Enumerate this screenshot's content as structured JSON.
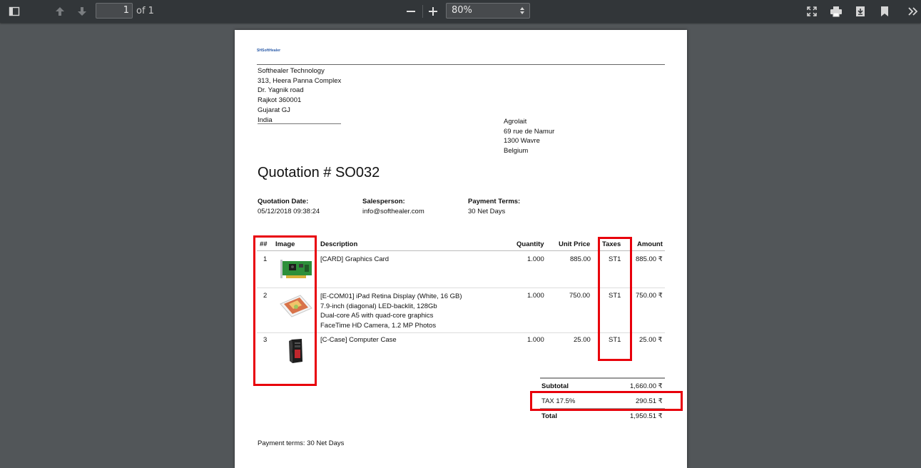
{
  "toolbar": {
    "page_number": "1",
    "page_of": "of 1",
    "zoom": "80%"
  },
  "document": {
    "logo_text": "SHSoftHealer",
    "company": {
      "name": "Softhealer Technology",
      "line1": "313, Heera Panna Complex",
      "line2": "Dr. Yagnik road",
      "line3": "Rajkot 360001",
      "line4": "Gujarat GJ",
      "line5": "India"
    },
    "partner": {
      "name": "Agrolait",
      "line1": "69 rue de Namur",
      "line2": "1300 Wavre",
      "line3": "Belgium"
    },
    "title": "Quotation # SO032",
    "info": {
      "date_label": "Quotation Date:",
      "date_value": "05/12/2018 09:38:24",
      "salesperson_label": "Salesperson:",
      "salesperson_value": "info@softhealer.com",
      "terms_label": "Payment Terms:",
      "terms_value": "30 Net Days"
    },
    "table": {
      "headers": {
        "num": "##",
        "image": "Image",
        "description": "Description",
        "quantity": "Quantity",
        "unit_price": "Unit Price",
        "taxes": "Taxes",
        "amount": "Amount"
      },
      "rows": [
        {
          "num": "1",
          "image": "graphics-card-image",
          "description": [
            "[CARD] Graphics Card"
          ],
          "quantity": "1.000",
          "unit_price": "885.00",
          "taxes": "ST1",
          "amount": "885.00 ₹"
        },
        {
          "num": "2",
          "image": "ipad-image",
          "description": [
            "[E-COM01] iPad Retina Display (White, 16 GB)",
            "7.9-inch (diagonal) LED-backlit, 128Gb",
            "Dual-core A5 with quad-core graphics",
            "FaceTime HD Camera, 1.2 MP Photos"
          ],
          "quantity": "1.000",
          "unit_price": "750.00",
          "taxes": "ST1",
          "amount": "750.00 ₹"
        },
        {
          "num": "3",
          "image": "computer-case-image",
          "description": [
            "[C-Case] Computer Case"
          ],
          "quantity": "1.000",
          "unit_price": "25.00",
          "taxes": "ST1",
          "amount": "25.00 ₹"
        }
      ]
    },
    "totals": {
      "subtotal_label": "Subtotal",
      "subtotal_value": "1,660.00 ₹",
      "tax_label": "TAX 17.5%",
      "tax_value": "290.51 ₹",
      "total_label": "Total",
      "total_value": "1,950.51 ₹"
    },
    "footer_terms": "Payment terms: 30 Net Days"
  },
  "colors": {
    "highlight": "#e8000b",
    "toolbar_bg": "#323639",
    "viewer_bg": "#525659"
  }
}
